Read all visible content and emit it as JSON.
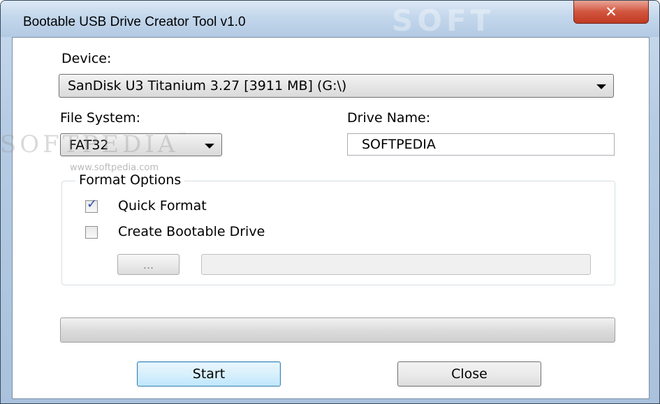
{
  "window": {
    "title": "Bootable USB Drive Creator Tool   v1.0",
    "title_watermark": "SOFT",
    "close_glyph": "✕"
  },
  "device": {
    "label": "Device:",
    "selected": "SanDisk  U3 Titanium        3.27 [3911 MB] (G:\\)"
  },
  "file_system": {
    "label": "File System:",
    "selected": "FAT32"
  },
  "drive_name": {
    "label": "Drive Name:",
    "value": "SOFTPEDIA"
  },
  "format_options": {
    "title": "Format Options",
    "quick_format": {
      "label": "Quick Format",
      "checked": true,
      "check_glyph": "✓"
    },
    "create_bootable": {
      "label": "Create Bootable Drive",
      "checked": false
    },
    "browse_label": "...",
    "path_value": ""
  },
  "progress": {
    "value": 0
  },
  "buttons": {
    "start": "Start",
    "close": "Close"
  },
  "watermark": {
    "brand": "SOFTPEDIA",
    "tm": "™",
    "url": "www.softpedia.com"
  },
  "icons": {
    "close": "close-icon",
    "dropdown": "chevron-down-icon",
    "check": "check-icon"
  },
  "colors": {
    "title_bar": "#c3d7ec",
    "close_button": "#c23a22",
    "check_mark": "#2b4aa8",
    "default_button_border": "#3c7fb1"
  }
}
